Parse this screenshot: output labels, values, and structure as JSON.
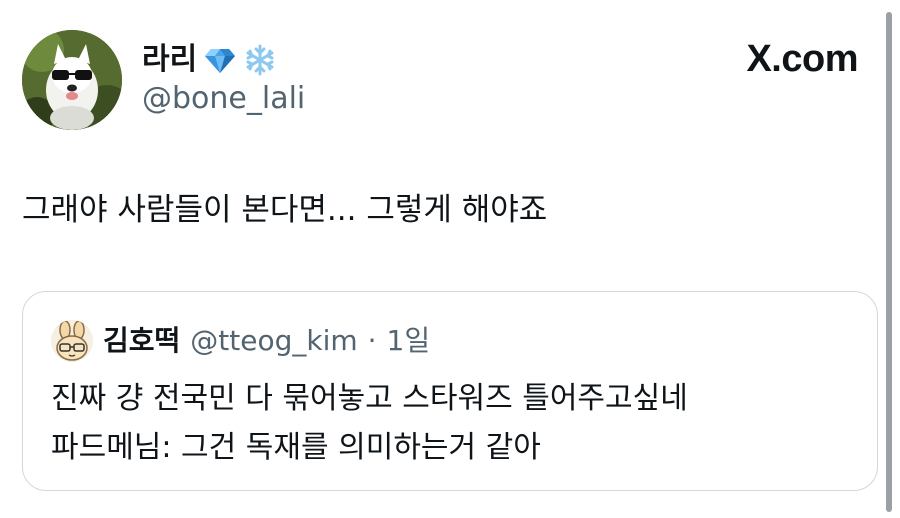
{
  "author": {
    "display_name": "라리",
    "handle": "@bone_lali",
    "badges": [
      "gem-icon",
      "snowflake-icon"
    ]
  },
  "site_label": "X.com",
  "tweet": {
    "text": "그래야 사람들이 본다면... 그렇게 해야죠"
  },
  "quote": {
    "display_name": "김호떡",
    "handle": "@tteog_kim",
    "separator": "·",
    "time": "1일",
    "lines": [
      "진짜 걍 전국민 다 묶어놓고 스타워즈 틀어주고싶네",
      "파드메님: 그건 독재를 의미하는거 같아"
    ]
  },
  "colors": {
    "text_primary": "#0f1419",
    "text_secondary": "#536471",
    "border": "#cfd9de",
    "gem": "#4aa3e8",
    "snowflake": "#8cc8f0"
  }
}
